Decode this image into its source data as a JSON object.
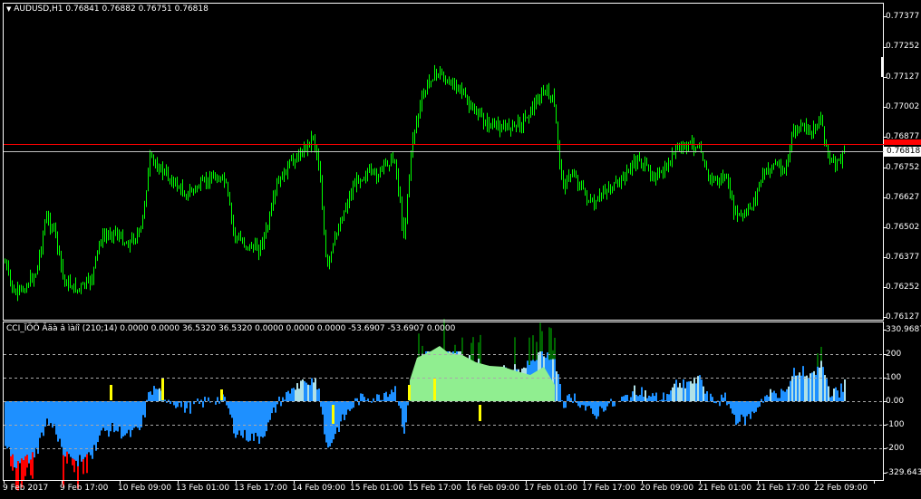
{
  "main": {
    "symbol_label": "AUDUSD,H1",
    "ohlc": "0.76841 0.76882 0.76751 0.76818",
    "y_labels": [
      "0.77377",
      "0.77252",
      "0.77127",
      "0.77002",
      "0.76877",
      "0.76752",
      "0.76627",
      "0.76502",
      "0.76377",
      "0.76252",
      "0.76127"
    ],
    "current_price_tag": "0.76818",
    "colors": {
      "candle": "#00ff00",
      "red_line": "#ff0000",
      "grey_line": "#c0c0c0",
      "frame": "#ffffff"
    }
  },
  "indicator": {
    "title": "CCI_ÏÖÖ Ãäà â ìàíî (210;14) 0.0000 0.0000 36.5320 36.5320 0.0000 0.0000 0.0000 -53.6907 -53.6907 0.0000",
    "y_labels": [
      "330.9687",
      "200",
      "100",
      "0.00",
      "-100",
      "-200",
      "-329.6433"
    ],
    "colors": {
      "blue": "#1e90ff",
      "light": "#b0e0e6",
      "green_fill": "#90ee90",
      "dark_green": "#006400",
      "red": "#ff0000",
      "yellow": "#ffff00"
    }
  },
  "time_axis": [
    "9 Feb 2017",
    "9 Feb 17:00",
    "10 Feb 09:00",
    "13 Feb 01:00",
    "13 Feb 17:00",
    "14 Feb 09:00",
    "15 Feb 01:00",
    "15 Feb 17:00",
    "16 Feb 09:00",
    "17 Feb 01:00",
    "17 Feb 17:00",
    "20 Feb 09:00",
    "21 Feb 01:00",
    "21 Feb 17:00",
    "22 Feb 09:00"
  ],
  "menu_icon": "triangle-down-icon"
}
